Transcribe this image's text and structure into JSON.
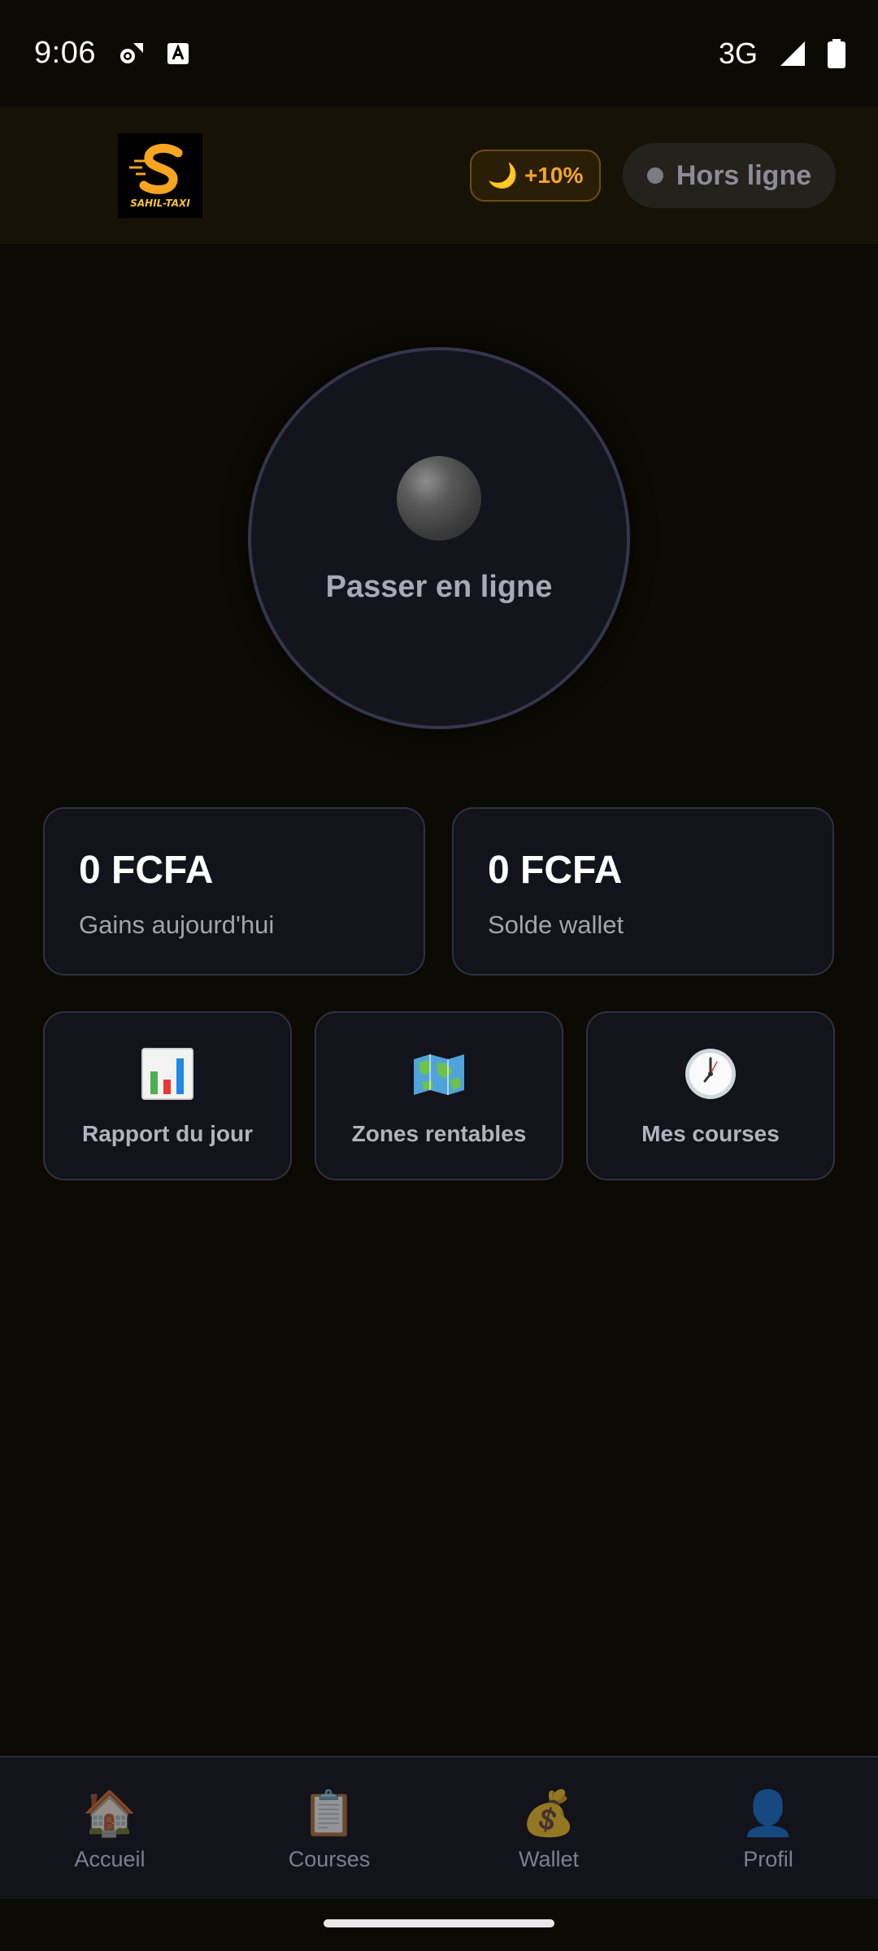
{
  "status_bar": {
    "time": "9:06",
    "network": "3G",
    "icons": [
      "settings-sync-icon",
      "keyboard-a-icon",
      "signal-icon",
      "battery-icon"
    ]
  },
  "header": {
    "logo_text": "SAHIL-TAXI",
    "night_bonus": "+10%",
    "night_bonus_icon": "moon-icon",
    "status_label": "Hors ligne",
    "accent_color": "#f4a52a"
  },
  "go_online": {
    "label": "Passer en ligne"
  },
  "stats": {
    "earnings_today_value": "0 FCFA",
    "earnings_today_label": "Gains aujourd'hui",
    "wallet_value": "0 FCFA",
    "wallet_label": "Solde wallet"
  },
  "actions": [
    {
      "label": "Rapport du jour",
      "icon": "bar-chart-icon"
    },
    {
      "label": "Zones rentables",
      "icon": "map-icon"
    },
    {
      "label": "Mes courses",
      "icon": "clock-icon"
    }
  ],
  "nav": [
    {
      "label": "Accueil",
      "icon": "🏠"
    },
    {
      "label": "Courses",
      "icon": "📋"
    },
    {
      "label": "Wallet",
      "icon": "💰"
    },
    {
      "label": "Profil",
      "icon": "👤"
    }
  ]
}
